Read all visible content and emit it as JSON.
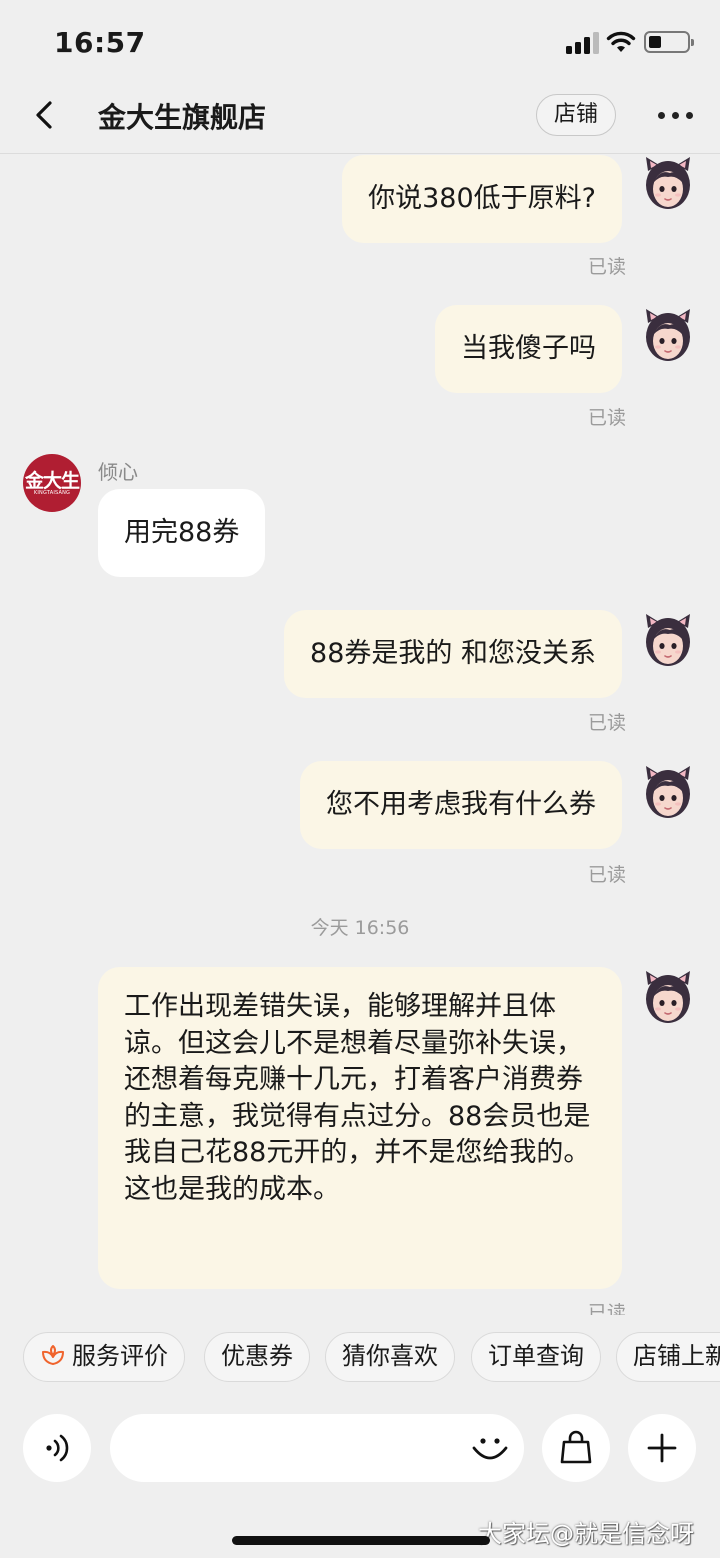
{
  "status_bar": {
    "time": "16:57"
  },
  "header": {
    "title": "金大生旗舰店",
    "store_button": "店铺"
  },
  "shop": {
    "agent_name": "倾心",
    "logo_text": "金大生",
    "logo_sub": "KINGTAISANG"
  },
  "messages": [
    {
      "text": "你说380低于原料?",
      "read": "已读"
    },
    {
      "text": "当我傻子吗",
      "read": "已读"
    },
    {
      "text": "用完88券"
    },
    {
      "text": "88券是我的 和您没关系",
      "read": "已读"
    },
    {
      "text": "您不用考虑我有什么券",
      "read": "已读"
    },
    {
      "text": "工作出现差错失误，能够理解并且体谅。但这会儿不是想着尽量弥补失误，还想着每克赚十几元，打着客户消费券的主意，我觉得有点过分。88会员也是我自己花88元开的，并不是您给我的。这也是我的成本。",
      "read": "已读"
    }
  ],
  "time_divider": "今天 16:56",
  "quick_replies": [
    "服务评价",
    "优惠券",
    "猜你喜欢",
    "订单查询",
    "店铺上新"
  ],
  "input": {
    "placeholder": ""
  },
  "icons": {
    "back": "chevron-left-icon",
    "more": "more-dots-icon",
    "voice": "voice-icon",
    "emoji": "smile-icon",
    "bag": "shopping-bag-icon",
    "add": "plus-icon",
    "rating": "flower-icon"
  },
  "colors": {
    "outgoing_bubble": "#fbf6e6",
    "incoming_bubble": "#ffffff",
    "brand": "#b01e32",
    "accent": "#f0642d"
  },
  "watermark": "大家坛@就是信念呀"
}
